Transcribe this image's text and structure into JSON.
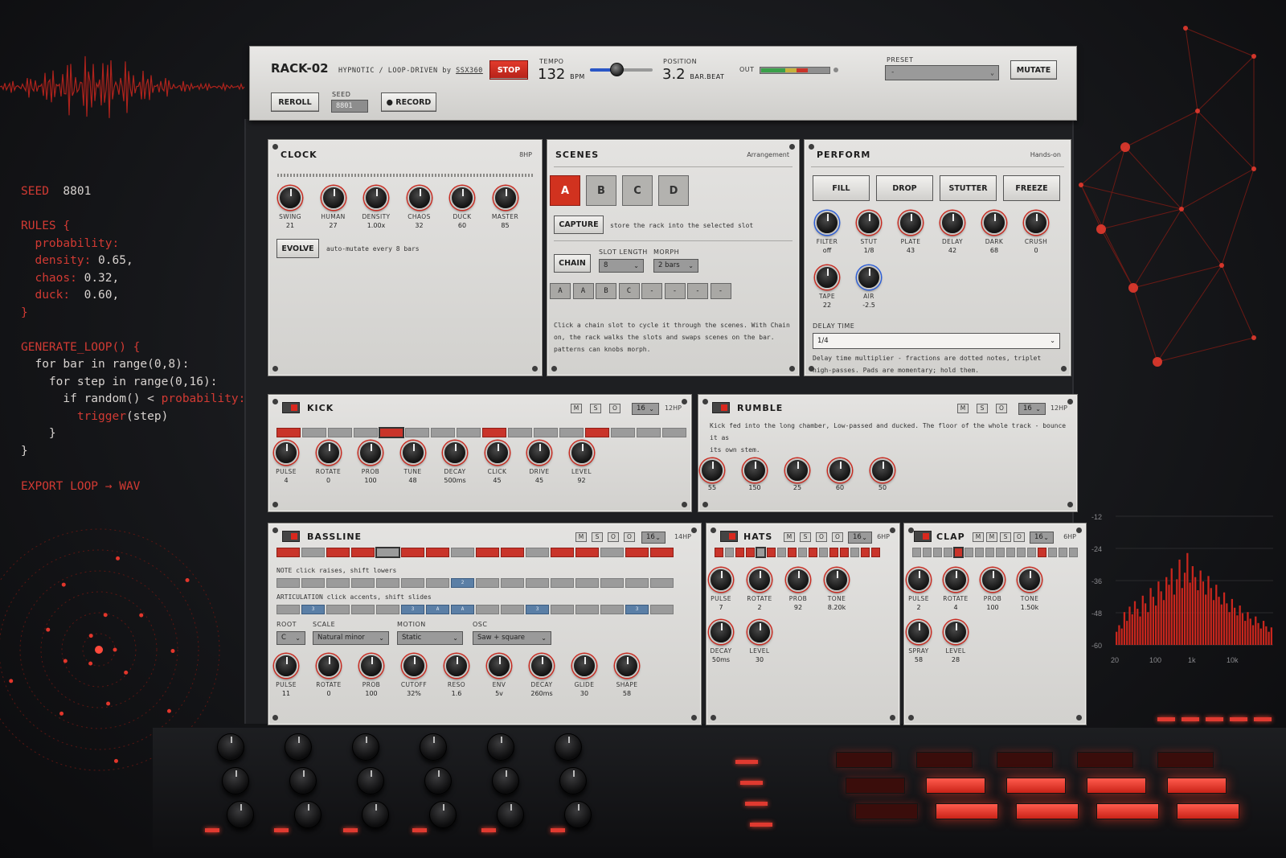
{
  "code": {
    "seed_kw": "SEED",
    "seed_val": "8801",
    "rules_open": "RULES {",
    "rules": [
      {
        "key": "probability:",
        "val": ""
      },
      {
        "key": "density:",
        "val": "0.65,"
      },
      {
        "key": "chaos:",
        "val": "0.32,"
      },
      {
        "key": "duck:",
        "val": " 0.60,"
      }
    ],
    "close": "}",
    "gen": "GENERATE_LOOP() {",
    "for1": "for bar in range(0,8):",
    "for2": "for step in range(0,16):",
    "if_a": "if random() <",
    "if_b": "probability:",
    "trig_a": "trigger",
    "trig_b": "(step)",
    "close_in": "}",
    "close_out": "}",
    "export": "EXPORT LOOP → WAV"
  },
  "spectrum": {
    "y_ticks": [
      "-12",
      "-24",
      "-36",
      "-48",
      "-60"
    ],
    "x_ticks": [
      "20",
      "100",
      "1k",
      "10k"
    ],
    "bars": [
      0.12,
      0.18,
      0.15,
      0.3,
      0.22,
      0.35,
      0.28,
      0.4,
      0.33,
      0.26,
      0.45,
      0.38,
      0.3,
      0.52,
      0.44,
      0.36,
      0.58,
      0.49,
      0.41,
      0.62,
      0.55,
      0.7,
      0.46,
      0.6,
      0.78,
      0.52,
      0.66,
      0.84,
      0.57,
      0.72,
      0.62,
      0.5,
      0.68,
      0.58,
      0.46,
      0.63,
      0.52,
      0.41,
      0.55,
      0.44,
      0.37,
      0.48,
      0.38,
      0.3,
      0.42,
      0.34,
      0.27,
      0.36,
      0.29,
      0.22,
      0.3,
      0.24,
      0.18,
      0.26,
      0.2,
      0.15,
      0.22,
      0.17,
      0.12,
      0.16
    ]
  },
  "header": {
    "title": "RACK-02",
    "subtitle_a": "HYPNOTIC / LOOP-DRIVEN",
    "subtitle_by": "by",
    "author": "SSX360",
    "stop_label": "STOP",
    "tempo_label": "TEMPO",
    "tempo_value": "132",
    "tempo_unit": "BPM",
    "tempo_level": 0.42,
    "position_label": "POSITION",
    "position_value": "3.2",
    "position_unit": "BAR.BEAT",
    "out_label": "OUT",
    "preset_label": "PRESET",
    "preset_value": "-",
    "mutate_label": "MUTATE",
    "reroll_label": "REROLL",
    "seed_label": "SEED",
    "seed_value": "8801",
    "record_label": "● RECORD"
  },
  "clock": {
    "title": "CLOCK",
    "hp": "8HP",
    "knobs": [
      {
        "label": "SWING",
        "value": "21"
      },
      {
        "label": "HUMAN",
        "value": "27"
      },
      {
        "label": "DENSITY",
        "value": "1.00x"
      },
      {
        "label": "CHAOS",
        "value": "32"
      },
      {
        "label": "DUCK",
        "value": "60"
      },
      {
        "label": "MASTER",
        "value": "85"
      }
    ],
    "evolve_label": "EVOLVE",
    "evolve_note": "auto-mutate every 8 bars"
  },
  "scenes": {
    "title": "SCENES",
    "tag": "Arrangement",
    "slots": [
      "A",
      "B",
      "C",
      "D"
    ],
    "capture_label": "CAPTURE",
    "capture_note": "store the rack into the selected slot",
    "chain_label": "CHAIN",
    "slot_length_label": "SLOT LENGTH",
    "slot_length_value": "8",
    "morph_label": "MORPH",
    "morph_value": "2 bars",
    "chain": [
      "A",
      "A",
      "B",
      "C",
      "-",
      "-",
      "-",
      "-"
    ],
    "help_1": "Click a chain slot to cycle it through the scenes. With Chain",
    "help_2": "on, the rack walks the slots and swaps scenes on the bar.",
    "help_3": "patterns can knobs morph."
  },
  "perform": {
    "title": "PERFORM",
    "tag": "Hands-on",
    "buttons": [
      "FILL",
      "DROP",
      "STUTTER",
      "FREEZE"
    ],
    "knobs": [
      {
        "label": "FILTER",
        "value": "off"
      },
      {
        "label": "STUT",
        "value": "1/8"
      },
      {
        "label": "PLATE",
        "value": "43"
      },
      {
        "label": "DELAY",
        "value": "42"
      },
      {
        "label": "DARK",
        "value": "68"
      },
      {
        "label": "CRUSH",
        "value": "0"
      },
      {
        "label": "TAPE",
        "value": "22"
      },
      {
        "label": "AIR",
        "value": "-2.5"
      }
    ],
    "delay_time_label": "DELAY TIME",
    "delay_time_value": "1/4",
    "help_1": "Delay time multiplier - fractions are dotted notes, triplet",
    "help_2": "high-passes. Pads are momentary; hold them."
  },
  "kick": {
    "title": "KICK",
    "hp": "12HP",
    "m": "M",
    "s": "S",
    "o": "O",
    "steps_sel": "16",
    "steps": [
      1,
      0,
      0,
      0,
      1,
      0,
      0,
      0,
      1,
      0,
      0,
      0,
      1,
      0,
      0,
      0
    ],
    "cur": 4,
    "knobs": [
      {
        "label": "PULSE",
        "value": "4"
      },
      {
        "label": "ROTATE",
        "value": "0"
      },
      {
        "label": "PROB",
        "value": "100"
      },
      {
        "label": "TUNE",
        "value": "48"
      },
      {
        "label": "DECAY",
        "value": "500ms"
      },
      {
        "label": "CLICK",
        "value": "45"
      },
      {
        "label": "DRIVE",
        "value": "45"
      },
      {
        "label": "LEVEL",
        "value": "92"
      }
    ]
  },
  "rumble": {
    "title": "RUMBLE",
    "hp": "12HP",
    "m": "M",
    "s": "S",
    "o": "O",
    "steps_sel": "16",
    "desc_1": "Kick fed into the long chamber, Low-passed and ducked. The floor of the whole track - bounce it as",
    "desc_2": "its own stem.",
    "knobs": [
      "55",
      "150",
      "25",
      "60",
      "50"
    ]
  },
  "bassline": {
    "title": "BASSLINE",
    "hp": "14HP",
    "m": "M",
    "s": "S",
    "o": "O",
    "o2": "O",
    "steps_sel": "16",
    "steps": [
      1,
      0,
      1,
      1,
      0,
      1,
      1,
      0,
      1,
      1,
      0,
      1,
      1,
      0,
      1,
      1
    ],
    "cur": 4,
    "note_label": "NOTE",
    "note_help": "click raises, shift lowers",
    "notes": [
      "",
      "",
      "",
      "",
      "",
      "",
      "",
      "2",
      "",
      "",
      "",
      "",
      "",
      "",
      "",
      ""
    ],
    "art_label": "ARTICULATION",
    "art_help": "click accents, shift slides",
    "arts": [
      "",
      "3",
      "",
      "",
      "",
      "3",
      "A",
      "A",
      "",
      "",
      "3",
      "",
      "",
      "",
      "3",
      ""
    ],
    "root_label": "ROOT",
    "root_value": "C",
    "scale_label": "SCALE",
    "scale_value": "Natural minor",
    "motion_label": "MOTION",
    "motion_value": "Static",
    "osc_label": "OSC",
    "osc_value": "Saw + square",
    "knobs": [
      {
        "label": "PULSE",
        "value": "11"
      },
      {
        "label": "ROTATE",
        "value": "0"
      },
      {
        "label": "PROB",
        "value": "100"
      },
      {
        "label": "CUTOFF",
        "value": "32%"
      },
      {
        "label": "RESO",
        "value": "1.6"
      },
      {
        "label": "ENV",
        "value": "5v"
      },
      {
        "label": "DECAY",
        "value": "260ms"
      },
      {
        "label": "GLIDE",
        "value": "30"
      },
      {
        "label": "SHAPE",
        "value": "58"
      }
    ]
  },
  "hats": {
    "title": "HATS",
    "hp": "6HP",
    "m": "M",
    "s": "S",
    "o": "O",
    "o2": "O",
    "steps_sel": "16",
    "steps": [
      1,
      0,
      1,
      1,
      0,
      1,
      0,
      1,
      0,
      1,
      0,
      1,
      1,
      0,
      1,
      1
    ],
    "cur": 4,
    "knobs": [
      {
        "label": "PULSE",
        "value": "7"
      },
      {
        "label": "ROTATE",
        "value": "2"
      },
      {
        "label": "PROB",
        "value": "92"
      },
      {
        "label": "TONE",
        "value": "8.20k"
      },
      {
        "label": "DECAY",
        "value": "50ms"
      },
      {
        "label": "LEVEL",
        "value": "30"
      }
    ]
  },
  "clap": {
    "title": "CLAP",
    "hp": "6HP",
    "m": "M",
    "m2": "M",
    "s": "S",
    "o": "O",
    "steps_sel": "16",
    "steps": [
      0,
      0,
      0,
      0,
      1,
      0,
      0,
      0,
      0,
      0,
      0,
      0,
      1,
      0,
      0,
      0
    ],
    "cur": 4,
    "knobs": [
      {
        "label": "PULSE",
        "value": "2"
      },
      {
        "label": "ROTATE",
        "value": "4"
      },
      {
        "label": "PROB",
        "value": "100"
      },
      {
        "label": "TONE",
        "value": "1.50k"
      },
      {
        "label": "SPRAY",
        "value": "58"
      },
      {
        "label": "LEVEL",
        "value": "28"
      }
    ]
  },
  "colors": {
    "accent": "#c9342a",
    "blue": "#2c5ed8"
  }
}
